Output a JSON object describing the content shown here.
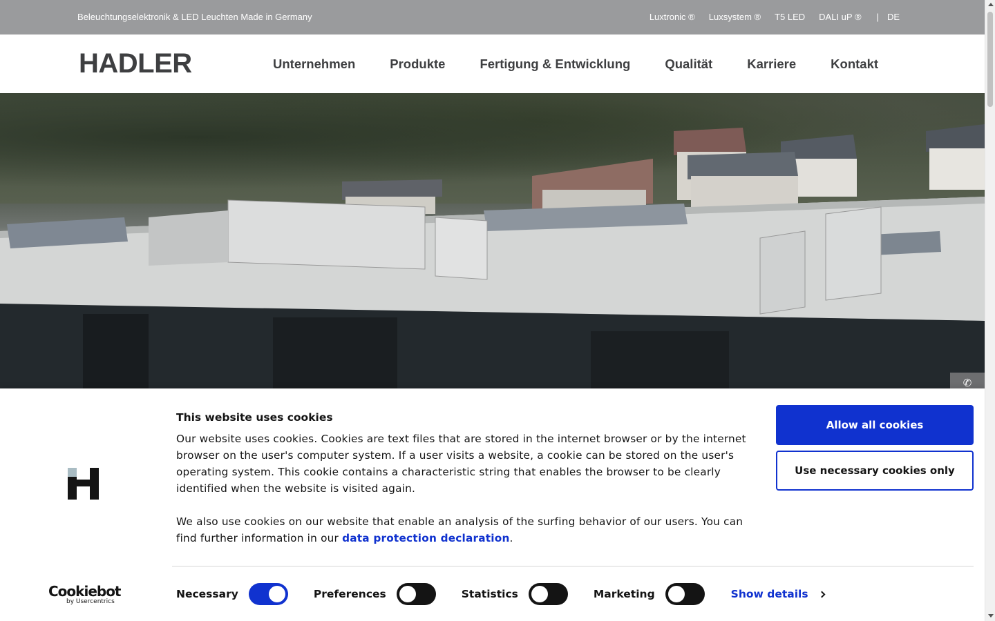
{
  "topbar": {
    "tagline": "Beleuchtungselektronik & LED Leuchten Made in Germany",
    "links": [
      "Luxtronic ®",
      "Luxsystem ®",
      "T5 LED",
      "DALI uP ®"
    ],
    "separator": "|",
    "language": "DE"
  },
  "header": {
    "logo_text": "HADLER",
    "nav": [
      "Unternehmen",
      "Produkte",
      "Fertigung & Entwicklung",
      "Qualität",
      "Karriere",
      "Kontakt"
    ]
  },
  "hero": {
    "phone_icon": "phone-icon"
  },
  "cookie_banner": {
    "title": "This website uses cookies",
    "paragraph1": "Our website uses cookies. Cookies are text files that are stored in the internet browser or by the internet browser on the user's computer system. If a user visits a website, a cookie can be stored on the user's operating system. This cookie contains a characteristic string that enables the browser to be clearly identified when the website is visited again.",
    "paragraph2_before": "We also use cookies on our website that enable an analysis of the surfing behavior of our users. You can find further information in our ",
    "paragraph2_link": "data protection declaration",
    "paragraph2_after": ".",
    "allow_all_label": "Allow all cookies",
    "necessary_only_label": "Use necessary cookies only",
    "toggles": [
      {
        "label": "Necessary",
        "on": true
      },
      {
        "label": "Preferences",
        "on": false
      },
      {
        "label": "Statistics",
        "on": false
      },
      {
        "label": "Marketing",
        "on": false
      }
    ],
    "show_details_label": "Show details",
    "cookiebot_name": "Cookiebot",
    "cookiebot_by": "by Usercentrics",
    "accent_color": "#1032cf"
  }
}
